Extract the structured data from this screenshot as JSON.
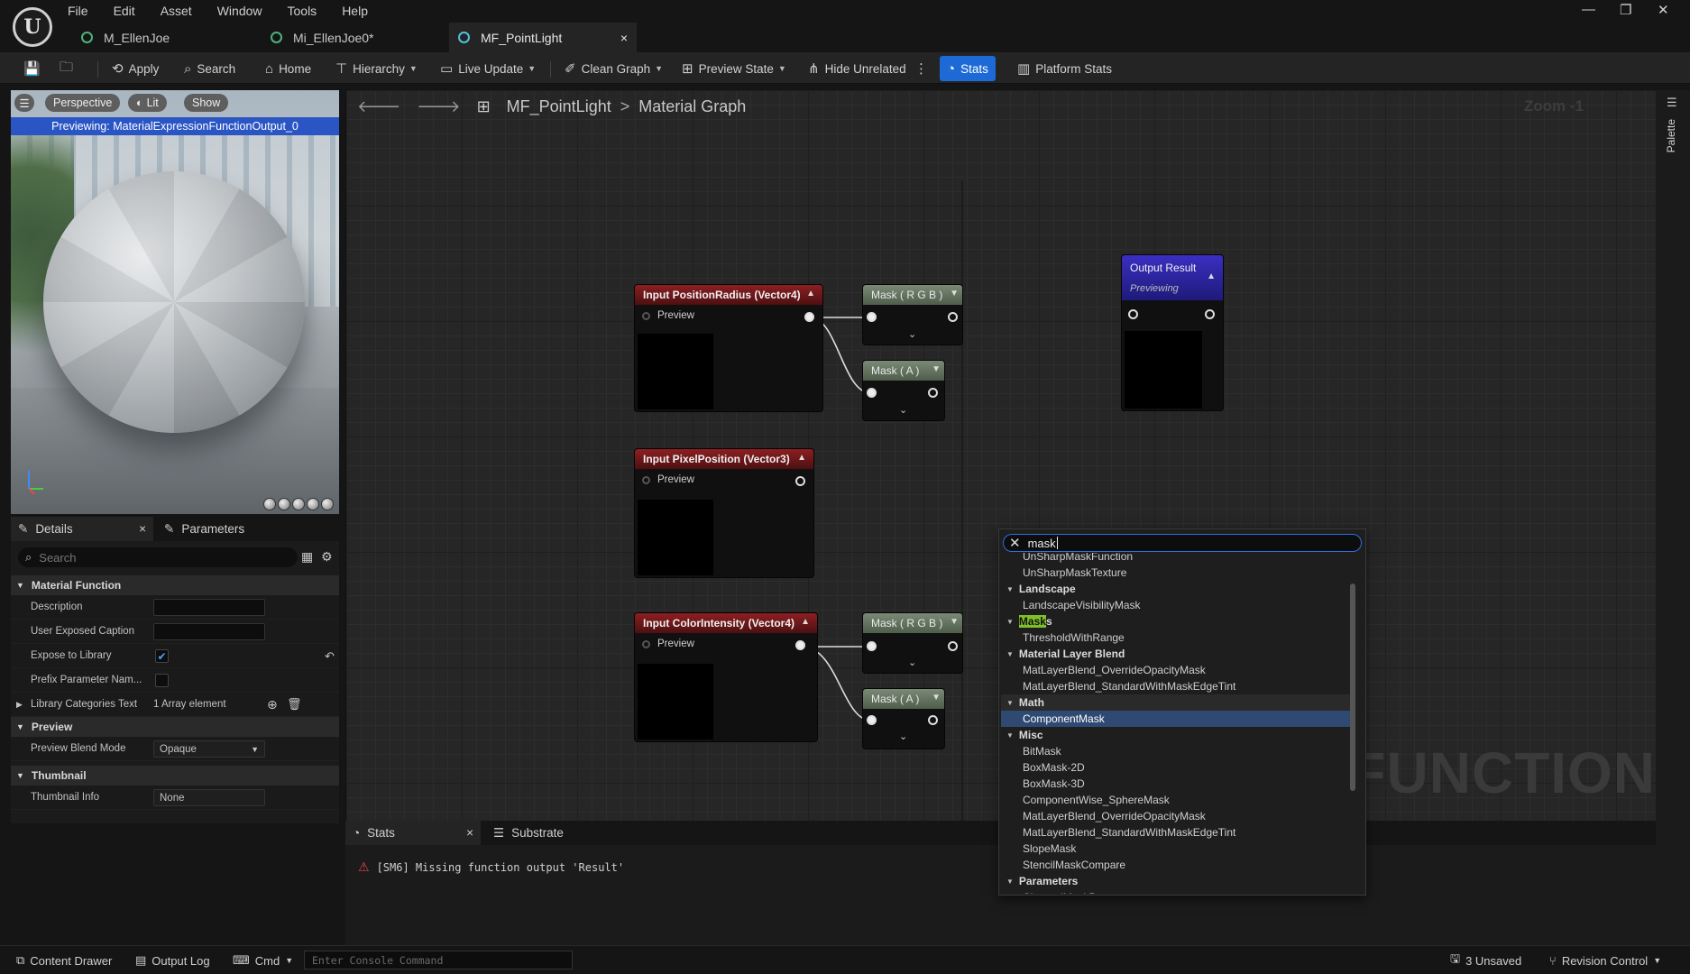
{
  "menu": [
    "File",
    "Edit",
    "Asset",
    "Window",
    "Tools",
    "Help"
  ],
  "doc_tabs": [
    {
      "label": "M_EllenJoe"
    },
    {
      "label": "Mi_EllenJoe0*"
    },
    {
      "label": "MF_PointLight",
      "close": "×"
    }
  ],
  "window_controls": {
    "minimize": "—",
    "restore": "❐",
    "close": "✕"
  },
  "toolbar": {
    "apply": "Apply",
    "search": "Search",
    "home": "Home",
    "hierarchy": "Hierarchy",
    "live_update": "Live Update",
    "clean_graph": "Clean Graph",
    "preview_state": "Preview State",
    "hide_unrelated": "Hide Unrelated",
    "stats": "Stats",
    "platform_stats": "Platform Stats"
  },
  "viewport": {
    "perspective": "Perspective",
    "lit": "Lit",
    "show": "Show",
    "previewing": "Previewing: MaterialExpressionFunctionOutput_0"
  },
  "details": {
    "tab_details": "Details",
    "tab_parameters": "Parameters",
    "search_placeholder": "Search",
    "sections": {
      "material_function": "Material Function",
      "preview": "Preview",
      "thumbnail": "Thumbnail"
    },
    "props": {
      "description": "Description",
      "user_exposed_caption": "User Exposed Caption",
      "expose_to_library": "Expose to Library",
      "prefix_parameter": "Prefix Parameter Nam...",
      "library_categories": "Library Categories Text",
      "library_categories_value": "1 Array element",
      "preview_blend_mode": "Preview Blend Mode",
      "preview_blend_mode_value": "Opaque",
      "thumbnail_info": "Thumbnail Info",
      "thumbnail_info_value": "None"
    }
  },
  "graph": {
    "crumb_asset": "MF_PointLight",
    "crumb_graph": "Material Graph",
    "zoom": "Zoom -1",
    "watermark": "L FUNCTION",
    "nodes": {
      "input_position_radius": "Input PositionRadius (Vector4)",
      "input_pixel_position": "Input PixelPosition (Vector3)",
      "input_color_intensity": "Input ColorIntensity (Vector4)",
      "mask_rgb": "Mask ( R G B )",
      "mask_a": "Mask ( A )",
      "output_result": "Output Result",
      "previewing": "Previewing",
      "preview_pin": "Preview"
    }
  },
  "stats_panel": {
    "tab_stats": "Stats",
    "tab_substrate": "Substrate",
    "error": "[SM6] Missing function output 'Result'"
  },
  "popup": {
    "query": "mask",
    "items": [
      {
        "type": "item",
        "label": "UnSharpMaskFunction"
      },
      {
        "type": "item",
        "label": "UnSharpMaskTexture"
      },
      {
        "type": "cat",
        "label": "Landscape"
      },
      {
        "type": "item",
        "label": "LandscapeVisibilityMask"
      },
      {
        "type": "cat",
        "label": "Masks",
        "highlight": "Mask",
        "rest": "s"
      },
      {
        "type": "item",
        "label": "ThresholdWithRange"
      },
      {
        "type": "cat",
        "label": "Material Layer Blend"
      },
      {
        "type": "item",
        "label": "MatLayerBlend_OverrideOpacityMask"
      },
      {
        "type": "item",
        "label": "MatLayerBlend_StandardWithMaskEdgeTint"
      },
      {
        "type": "cat",
        "label": "Math",
        "selected_cat": true
      },
      {
        "type": "item",
        "label": "ComponentMask",
        "selected": true
      },
      {
        "type": "cat",
        "label": "Misc"
      },
      {
        "type": "item",
        "label": "BitMask"
      },
      {
        "type": "item",
        "label": "BoxMask-2D"
      },
      {
        "type": "item",
        "label": "BoxMask-3D"
      },
      {
        "type": "item",
        "label": "ComponentWise_SphereMask"
      },
      {
        "type": "item",
        "label": "MatLayerBlend_OverrideOpacityMask"
      },
      {
        "type": "item",
        "label": "MatLayerBlend_StandardWithMaskEdgeTint"
      },
      {
        "type": "item",
        "label": "SlopeMask"
      },
      {
        "type": "item",
        "label": "StencilMaskCompare"
      },
      {
        "type": "cat",
        "label": "Parameters"
      },
      {
        "type": "item",
        "label": "ChannelMaskParameter"
      }
    ]
  },
  "statusbar": {
    "content_drawer": "Content Drawer",
    "output_log": "Output Log",
    "cmd": "Cmd",
    "console_placeholder": "Enter Console Command",
    "unsaved": "3 Unsaved",
    "revision_control": "Revision Control"
  },
  "right_strip": {
    "palette": "Palette"
  },
  "colors": {
    "accent": "#1d6ad6",
    "node_red": "#8c1f22",
    "node_green": "#6f7f6b",
    "output_blue": "#3a2fc2",
    "selection": "#2f4a72",
    "highlight": "#7fbf2a"
  }
}
